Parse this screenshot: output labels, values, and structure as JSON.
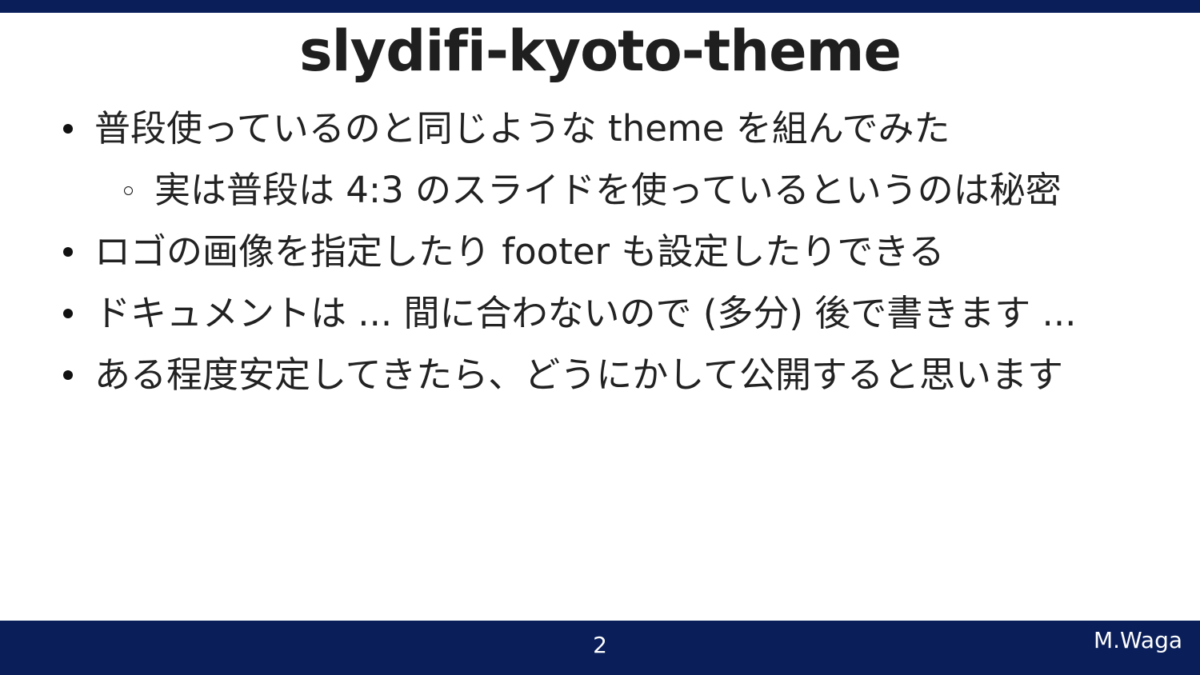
{
  "slide": {
    "title": "slydifi-kyoto-theme",
    "bullets": [
      {
        "text": "普段使っているのと同じような theme を組んでみた",
        "level": 1
      },
      {
        "text": "実は普段は 4:3 のスライドを使っているというのは秘密",
        "level": 2
      },
      {
        "text": "ロゴの画像を指定したり footer も設定したりできる",
        "level": 1
      },
      {
        "text": "ドキュメントは ... 間に合わないので (多分) 後で書きます ...",
        "level": 1
      },
      {
        "text": "ある程度安定してきたら、どうにかして公開すると思います",
        "level": 1
      }
    ]
  },
  "footer": {
    "page_number": "2",
    "author": "M.Waga"
  },
  "colors": {
    "bar": "#0a1f5a",
    "text": "#222222"
  }
}
